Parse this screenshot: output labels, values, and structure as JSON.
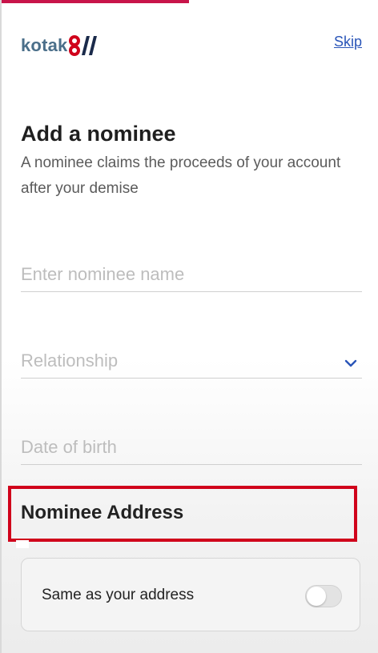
{
  "progress": {
    "fraction": 0.5,
    "color": "#c8144a"
  },
  "header": {
    "logo_text": "kotak",
    "logo_icon": "kotak-infinity-logo-icon",
    "skip_label": "Skip"
  },
  "page": {
    "title": "Add a nominee",
    "subtitle": "A nominee claims the proceeds of your account after your demise"
  },
  "form": {
    "name": {
      "placeholder": "Enter nominee name",
      "value": ""
    },
    "relationship": {
      "placeholder": "Relationship",
      "value": "",
      "icon": "chevron-down-icon"
    },
    "dob": {
      "placeholder": "Date of birth",
      "value": ""
    }
  },
  "address_section": {
    "title": "Nominee Address",
    "same_as_label": "Same as your address",
    "toggle_on": false
  },
  "colors": {
    "brand_red": "#d0021b",
    "link_blue": "#2a55b8",
    "logo_blue": "#4b6f8a"
  }
}
